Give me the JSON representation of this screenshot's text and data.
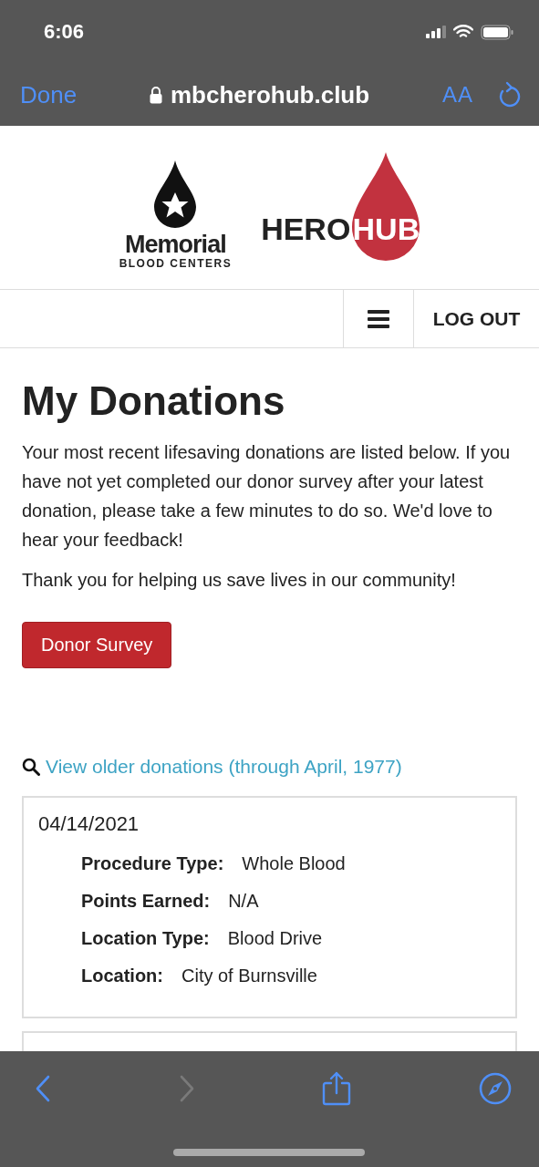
{
  "status_bar": {
    "time": "6:06"
  },
  "browser_bar": {
    "done": "Done",
    "url": "mbcherohub.club",
    "text_size": "AA"
  },
  "logos": {
    "memorial": {
      "name": "Memorial",
      "subtitle": "BLOOD CENTERS"
    },
    "herohub": {
      "left": "HERO",
      "right": "HUB"
    }
  },
  "nav": {
    "logout": "LOG OUT"
  },
  "page": {
    "title": "My Donations",
    "paragraphs": [
      "Your most recent lifesaving donations are listed below. If you have not yet completed our donor survey after your latest donation, please take a few minutes to do so. We'd love to hear your feedback!",
      "Thank you for helping us save lives in our community!"
    ],
    "survey_button": "Donor Survey",
    "older_link": "View older donations (through April, 1977)"
  },
  "donations": [
    {
      "date": "04/14/2021",
      "fields": [
        {
          "label": "Procedure Type:",
          "value": "Whole Blood"
        },
        {
          "label": "Points Earned:",
          "value": "N/A"
        },
        {
          "label": "Location Type:",
          "value": "Blood Drive"
        },
        {
          "label": "Location:",
          "value": "City of Burnsville"
        }
      ]
    }
  ],
  "toolbar": {
    "back_disabled": false,
    "forward_disabled": true
  }
}
